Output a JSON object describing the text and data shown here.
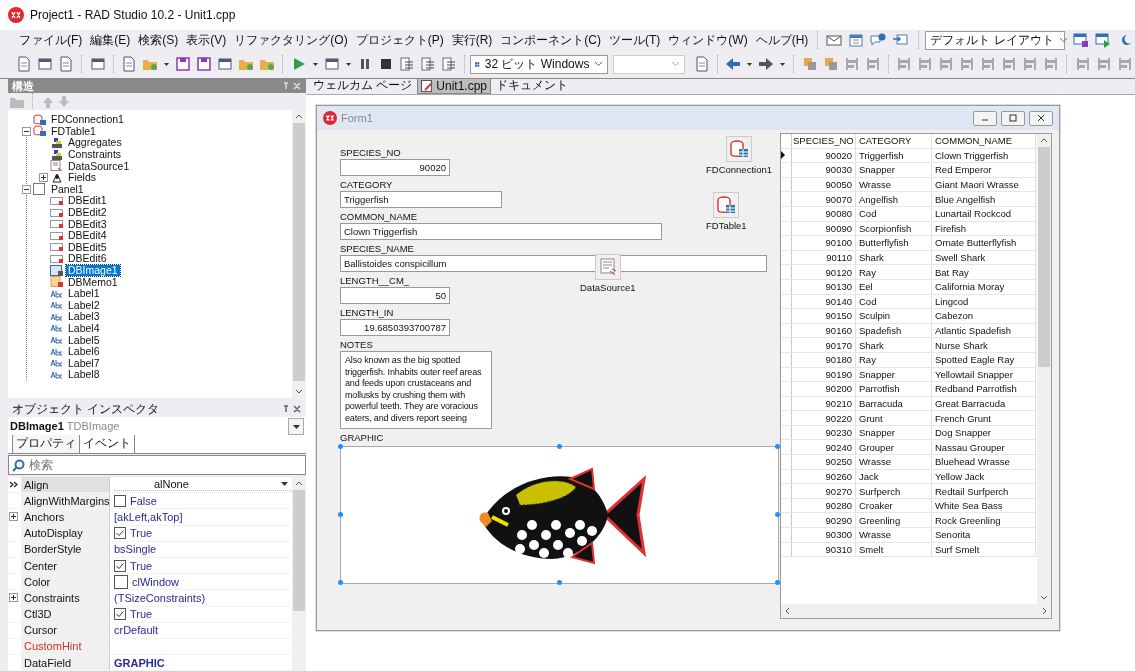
{
  "window": {
    "title": "Project1 - RAD Studio 10.2 - Unit1.cpp"
  },
  "menu": [
    "ファイル(F)",
    "編集(E)",
    "検索(S)",
    "表示(V)",
    "リファクタリング(O)",
    "プロジェクト(P)",
    "実行(R)",
    "コンポーネント(C)",
    "ツール(T)",
    "ウィンドウ(W)",
    "ヘルプ(H)"
  ],
  "toolbar": {
    "platform": "32 ビット Windows",
    "layout": "デフォルト レイアウト"
  },
  "structure": {
    "title": "構造",
    "tree": [
      {
        "label": "FDConnection1",
        "kind": "connection",
        "selected": false
      },
      {
        "label": "FDTable1",
        "kind": "table",
        "selected": false,
        "expanded": true,
        "children": [
          {
            "label": "Aggregates",
            "kind": "aggregates",
            "selected": false
          },
          {
            "label": "Constraints",
            "kind": "aggregates",
            "selected": false
          },
          {
            "label": "DataSource1",
            "kind": "datasource",
            "selected": false
          },
          {
            "label": "Fields",
            "kind": "fields",
            "selected": false,
            "expanded": false
          }
        ]
      },
      {
        "label": "Panel1",
        "kind": "panel",
        "selected": false,
        "expanded": true,
        "children": [
          {
            "label": "DBEdit1",
            "kind": "edit",
            "selected": false
          },
          {
            "label": "DBEdit2",
            "kind": "edit",
            "selected": false
          },
          {
            "label": "DBEdit3",
            "kind": "edit",
            "selected": false
          },
          {
            "label": "DBEdit4",
            "kind": "edit",
            "selected": false
          },
          {
            "label": "DBEdit5",
            "kind": "edit",
            "selected": false
          },
          {
            "label": "DBEdit6",
            "kind": "edit",
            "selected": false
          },
          {
            "label": "DBImage1",
            "kind": "image",
            "selected": true
          },
          {
            "label": "DBMemo1",
            "kind": "memo",
            "selected": false
          },
          {
            "label": "Label1",
            "kind": "label",
            "selected": false
          },
          {
            "label": "Label2",
            "kind": "label",
            "selected": false
          },
          {
            "label": "Label3",
            "kind": "label",
            "selected": false
          },
          {
            "label": "Label4",
            "kind": "label",
            "selected": false
          },
          {
            "label": "Label5",
            "kind": "label",
            "selected": false
          },
          {
            "label": "Label6",
            "kind": "label",
            "selected": false
          },
          {
            "label": "Label7",
            "kind": "label",
            "selected": false
          },
          {
            "label": "Label8",
            "kind": "label",
            "selected": false
          }
        ]
      }
    ]
  },
  "inspector": {
    "title": "オブジェクト インスペクタ",
    "component_name": "DBImage1",
    "component_type": "TDBImage",
    "tabs": [
      {
        "label": "プロパティ",
        "selected": true
      },
      {
        "label": "イベント",
        "selected": false
      }
    ],
    "search": {
      "placeholder": "検索"
    },
    "properties": [
      {
        "name": "Align",
        "value": "alNone",
        "kind": "dropdown",
        "selected": true
      },
      {
        "name": "AlignWithMargins",
        "value": "False",
        "kind": "check",
        "checked": false,
        "selected": false
      },
      {
        "name": "Anchors",
        "value": "[akLeft,akTop]",
        "kind": "set",
        "selected": false
      },
      {
        "name": "AutoDisplay",
        "value": "True",
        "kind": "check",
        "checked": true,
        "selected": false
      },
      {
        "name": "BorderStyle",
        "value": "bsSingle",
        "kind": "text",
        "selected": false
      },
      {
        "name": "Center",
        "value": "True",
        "kind": "check",
        "checked": true,
        "selected": false
      },
      {
        "name": "Color",
        "value": "clWindow",
        "kind": "color",
        "selected": false
      },
      {
        "name": "Constraints",
        "value": "(TSizeConstraints)",
        "kind": "set",
        "selected": false
      },
      {
        "name": "Ctl3D",
        "value": "True",
        "kind": "check",
        "checked": true,
        "selected": false
      },
      {
        "name": "Cursor",
        "value": "crDefault",
        "kind": "text",
        "selected": false
      },
      {
        "name": "CustomHint",
        "kind": "text",
        "color": "#c0392b",
        "selected": false
      },
      {
        "name": "DataField",
        "value": "GRAPHIC",
        "kind": "field",
        "selected": false
      }
    ]
  },
  "document_tabs": [
    {
      "label": "ウェルカム ページ",
      "selected": false
    },
    {
      "label": "Unit1.cpp",
      "selected": true
    },
    {
      "label": "ドキュメント",
      "selected": false
    }
  ],
  "form": {
    "title": "Form1",
    "fields": [
      {
        "label": "SPECIES_NO",
        "value": "90020",
        "kind": "number"
      },
      {
        "label": "CATEGORY",
        "value": "Triggerfish",
        "kind": "text"
      },
      {
        "label": "COMMON_NAME",
        "value": "Clown Triggerfish",
        "kind": "text"
      },
      {
        "label": "SPECIES_NAME",
        "value": "Ballistoides conspicillum",
        "kind": "text"
      },
      {
        "label": "LENGTH__CM_",
        "value": "50",
        "kind": "number"
      },
      {
        "label": "LENGTH_IN",
        "value": "19.6850393700787",
        "kind": "number"
      }
    ],
    "notes": {
      "label": "NOTES",
      "text": "Also known as the big spotted triggerfish.  Inhabits outer reef areas and feeds upon crustaceans and mollusks by crushing them with powerful teeth.  They are voracious eaters, and divers report seeing"
    },
    "graphic": {
      "label": "GRAPHIC",
      "selected": true
    },
    "grid": {
      "columns": [
        "SPECIES_NO",
        "CATEGORY",
        "COMMON_NAME"
      ],
      "rows": [
        [
          "90020",
          "Triggerfish",
          "Clown Triggerfish"
        ],
        [
          "90030",
          "Snapper",
          "Red Emperor"
        ],
        [
          "90050",
          "Wrasse",
          "Giant Maori Wrasse"
        ],
        [
          "90070",
          "Angelfish",
          "Blue Angelfish"
        ],
        [
          "90080",
          "Cod",
          "Lunartail Rockcod"
        ],
        [
          "90090",
          "Scorpionfish",
          "Firefish"
        ],
        [
          "90100",
          "Butterflyfish",
          "Ornate Butterflyfish"
        ],
        [
          "90110",
          "Shark",
          "Swell Shark"
        ],
        [
          "90120",
          "Ray",
          "Bat Ray"
        ],
        [
          "90130",
          "Eel",
          "California Moray"
        ],
        [
          "90140",
          "Cod",
          "Lingcod"
        ],
        [
          "90150",
          "Sculpin",
          "Cabezon"
        ],
        [
          "90160",
          "Spadefish",
          "Atlantic Spadefish"
        ],
        [
          "90170",
          "Shark",
          "Nurse Shark"
        ],
        [
          "90180",
          "Ray",
          "Spotted Eagle Ray"
        ],
        [
          "90190",
          "Snapper",
          "Yellowtail Snapper"
        ],
        [
          "90200",
          "Parrotfish",
          "Redband Parrotfish"
        ],
        [
          "90210",
          "Barracuda",
          "Great Barracuda"
        ],
        [
          "90220",
          "Grunt",
          "French Grunt"
        ],
        [
          "90230",
          "Snapper",
          "Dog Snapper"
        ],
        [
          "90240",
          "Grouper",
          "Nassau Grouper"
        ],
        [
          "90250",
          "Wrasse",
          "Bluehead Wrasse"
        ],
        [
          "90260",
          "Jack",
          "Yellow Jack"
        ],
        [
          "90270",
          "Surfperch",
          "Redtail Surfperch"
        ],
        [
          "90280",
          "Croaker",
          "White Sea Bass"
        ],
        [
          "90290",
          "Greenling",
          "Rock Greenling"
        ],
        [
          "90300",
          "Wrasse",
          "Senorita"
        ],
        [
          "90310",
          "Smelt",
          "Surf Smelt"
        ]
      ]
    },
    "components": [
      {
        "name": "FDConnection1",
        "kind": "connection"
      },
      {
        "name": "FDTable1",
        "kind": "table"
      },
      {
        "name": "DataSource1",
        "kind": "datasource"
      }
    ]
  }
}
